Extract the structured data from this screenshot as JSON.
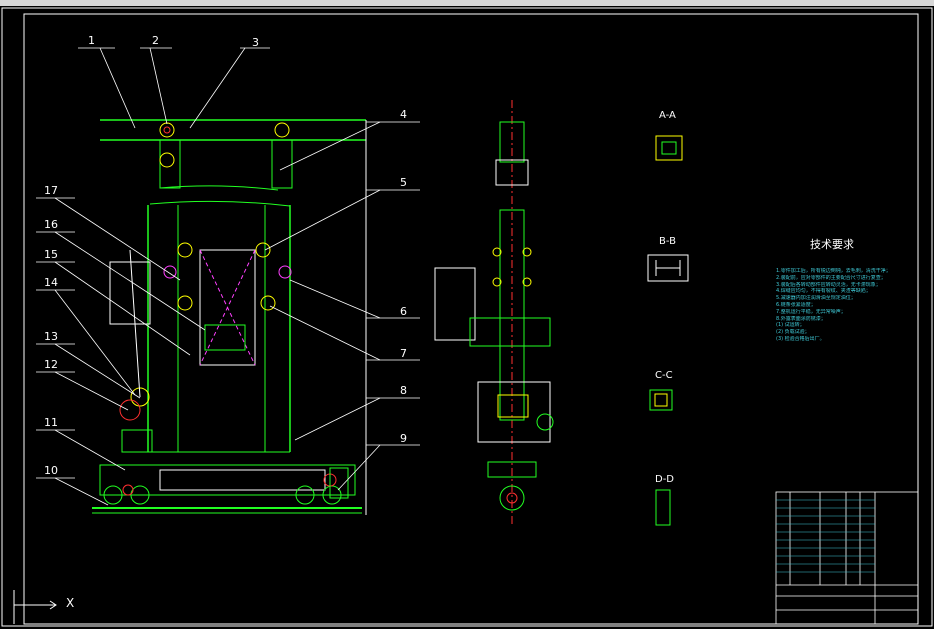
{
  "window": {
    "title": ""
  },
  "part_labels": [
    "1",
    "2",
    "3",
    "4",
    "5",
    "6",
    "7",
    "8",
    "9",
    "10",
    "11",
    "12",
    "13",
    "14",
    "15",
    "16",
    "17"
  ],
  "section_views": {
    "aa": "A-A",
    "bb": "B-B",
    "cc": "C-C",
    "dd": "D-D"
  },
  "technical_requirements": {
    "title": "技术要求",
    "lines": [
      "1.零件加工后，所有锐边倒钝，去毛刺，清洗干净；",
      "2.装配前，应对零部件的主要配合尺寸进行复查；",
      "3.装配后各转动部件应转动灵活，无卡滞现象；",
      "4.焊缝应均匀，不得有裂纹、夹渣等缺陷；",
      "5.减速器内加注润滑油至规定油位；",
      "6.链条张紧适度；",
      "7.整机运行平稳，无异常噪声；",
      "8.外露表面涂防锈漆；",
      "(1) 试运转；",
      "(2) 负载试验；",
      "(3) 检验合格后出厂。"
    ]
  },
  "title_block": {
    "name": "",
    "drawing_name": ""
  },
  "colors": {
    "frame": "#ffffff",
    "green": "#22ff22",
    "yellow": "#ffff00",
    "red": "#ff3030",
    "magenta": "#ff40ff",
    "cyan": "#3fc9d6",
    "background": "#000000"
  }
}
